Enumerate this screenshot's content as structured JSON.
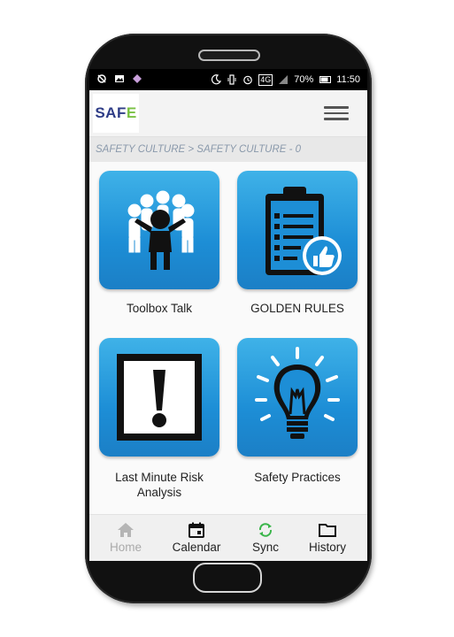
{
  "statusbar": {
    "battery": "70%",
    "time": "11:50",
    "network": "4G"
  },
  "app": {
    "logo": {
      "prefix": "SAF",
      "accent": "E"
    }
  },
  "breadcrumb": "SAFETY CULTURE > SAFETY CULTURE - 0",
  "tiles": [
    {
      "label": "Toolbox Talk",
      "icon": "group-leader-icon"
    },
    {
      "label": "GOLDEN RULES",
      "icon": "clipboard-thumbs-up-icon"
    },
    {
      "label": "Last Minute Risk Analysis",
      "icon": "exclamation-sign-icon"
    },
    {
      "label": "Safety Practices",
      "icon": "lightbulb-icon"
    }
  ],
  "nav": {
    "home": "Home",
    "calendar": "Calendar",
    "sync": "Sync",
    "history": "History"
  },
  "colors": {
    "tile": "#1d8ed6",
    "sync_accent": "#3ab54a",
    "logo": "#2f3d87",
    "logo_accent": "#7ac143"
  }
}
